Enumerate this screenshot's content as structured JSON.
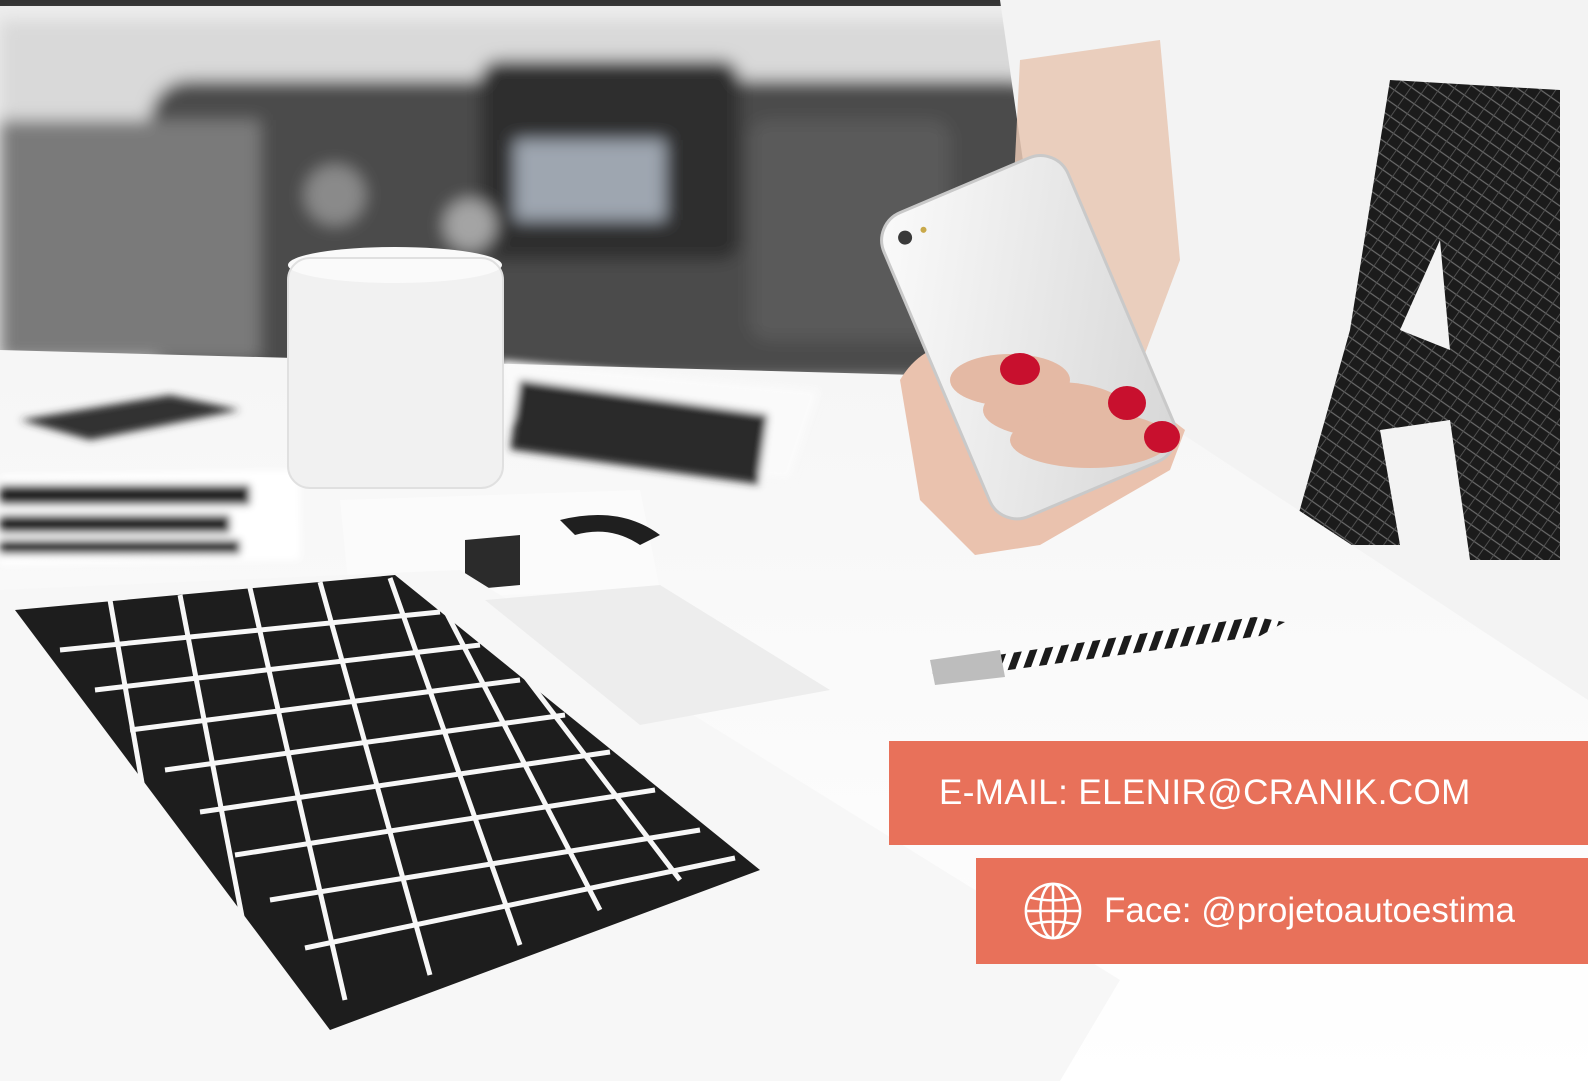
{
  "contact": {
    "email_text": "E-MAIL: ELENIR@CRANIK.COM",
    "face_text": "Face: @projetoautoestima",
    "face_icon": "globe-icon",
    "accent_color": "#e8715a"
  }
}
